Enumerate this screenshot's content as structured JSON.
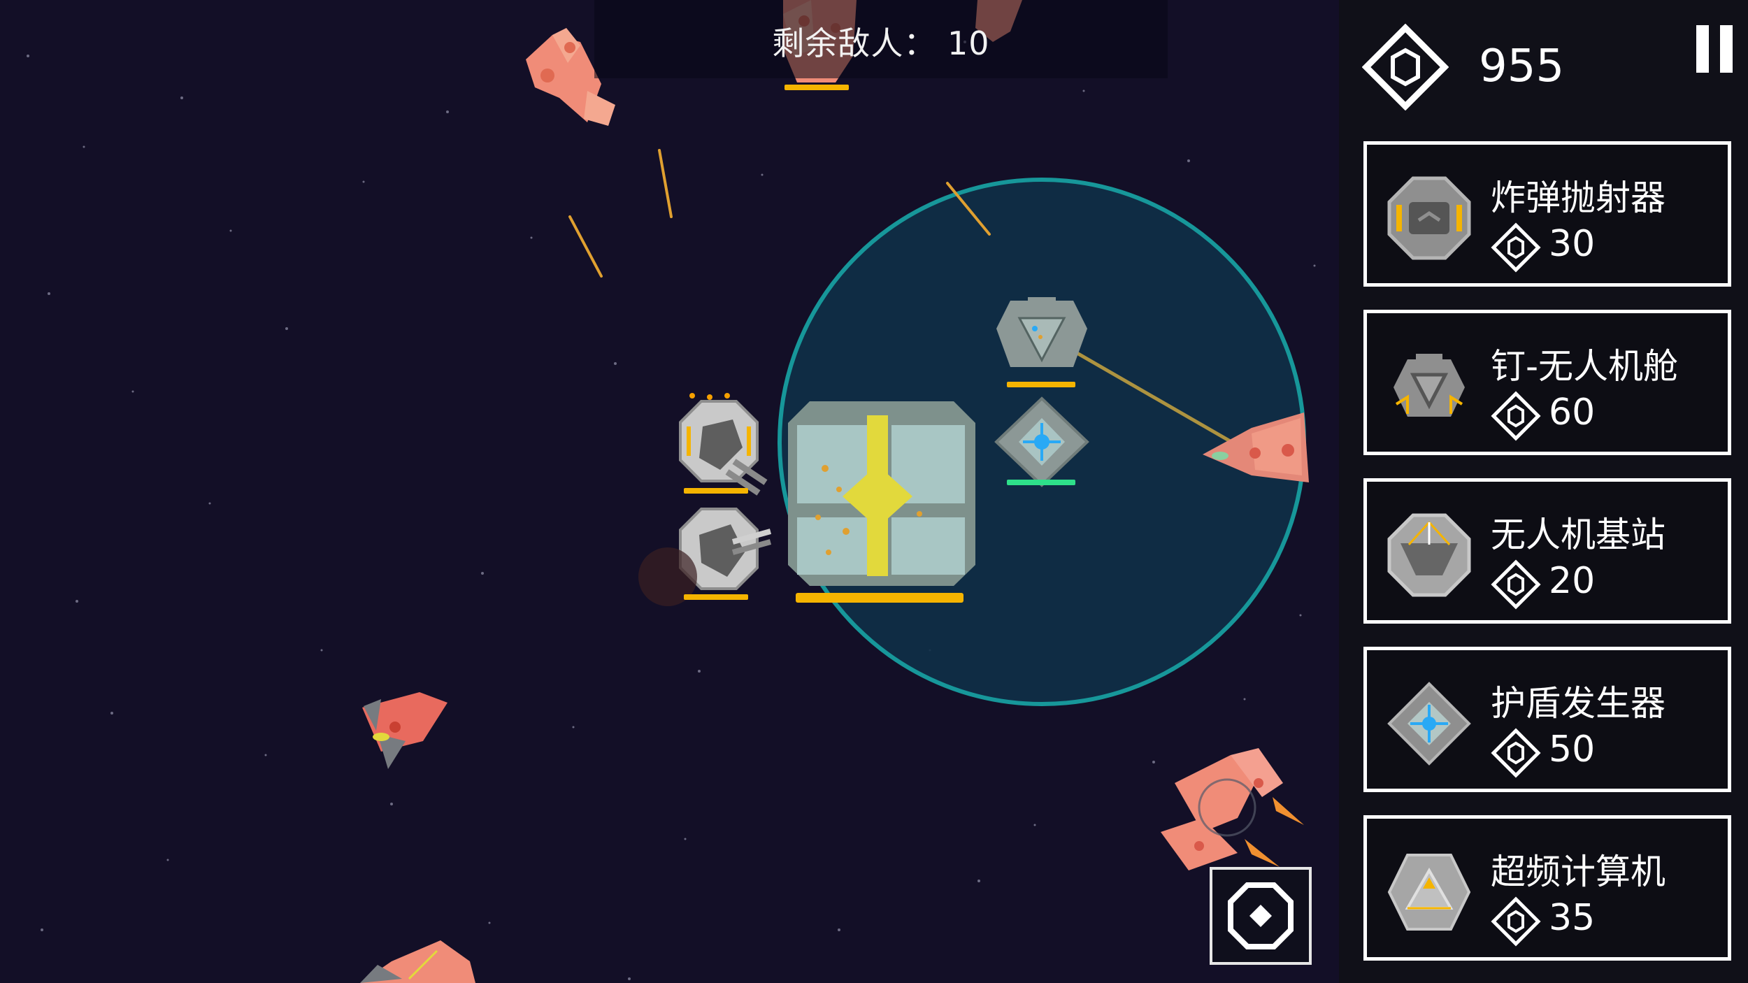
{
  "hud": {
    "enemies_remaining_text": "剩余敌人： 10",
    "currency": "955",
    "currency_icon": "gem-hexagon-icon",
    "pause_icon": "pause-icon",
    "build_icon": "build-mode-icon"
  },
  "shop": {
    "items": [
      {
        "label": "炸弹抛射器",
        "cost": "30",
        "icon": "bomb-launcher-icon"
      },
      {
        "label": "钉-无人机舱",
        "cost": "60",
        "icon": "nail-drone-bay-icon"
      },
      {
        "label": "无人机基站",
        "cost": "20",
        "icon": "drone-base-icon"
      },
      {
        "label": "护盾发生器",
        "cost": "50",
        "icon": "shield-generator-icon"
      },
      {
        "label": "超频计算机",
        "cost": "35",
        "icon": "overclock-computer-icon"
      }
    ]
  },
  "colors": {
    "background": "#130f27",
    "shield_fill": "#103048",
    "shield_ring": "#17979a",
    "enemy": "#f08c78",
    "health_bar": "#f5b400",
    "shield_bar": "#2ee08a",
    "accent_blue": "#29a9f5",
    "panel": "#101018"
  }
}
